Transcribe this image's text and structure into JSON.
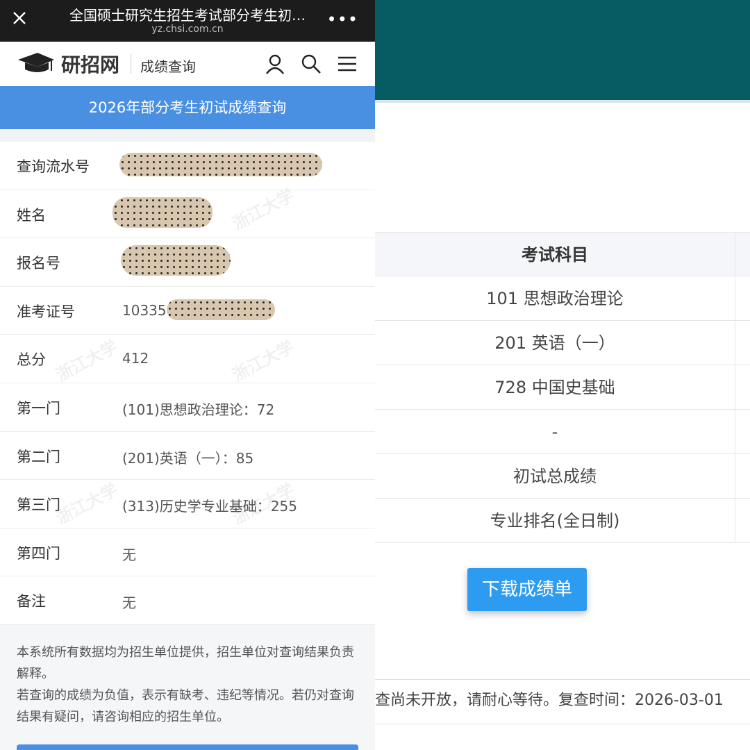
{
  "browser": {
    "title": "全国硕士研究生招生考试部分考生初…",
    "url": "yz.chsi.com.cn"
  },
  "site": {
    "name": "研招网",
    "section": "成绩查询"
  },
  "banner": "2026年部分考生初试成绩查询",
  "watermark": "浙江大学",
  "fields": [
    {
      "label": "查询流水号",
      "value": ""
    },
    {
      "label": "姓名",
      "value": ""
    },
    {
      "label": "报名号",
      "value": ""
    },
    {
      "label": "准考证号",
      "value": "10335"
    },
    {
      "label": "总分",
      "value": "412"
    },
    {
      "label": "第一门",
      "value": "(101)思想政治理论：72"
    },
    {
      "label": "第二门",
      "value": "(201)英语（一）：85"
    },
    {
      "label": "第三门",
      "value": "(313)历史学专业基础：255"
    },
    {
      "label": "第四门",
      "value": "无"
    },
    {
      "label": "备注",
      "value": "无"
    }
  ],
  "notice": {
    "line1": "本系统所有数据均为招生单位提供，招生单位对查询结果负责解释。",
    "line2": "若查询的成绩为负值，表示有缺考、违纪等情况。若仍对查询结果有疑问，请咨询相应的招生单位。"
  },
  "score_table": {
    "header": "考试科目",
    "rows": [
      "101 思想政治理论",
      "201 英语（一）",
      "728 中国史基础",
      "-",
      "初试总成绩",
      "专业排名(全日制)"
    ]
  },
  "download_button": "下载成绩单",
  "review_text": "查尚未开放，请耐心等待。复查时间：2026-03-01",
  "colors": {
    "banner_blue": "#4a90e2",
    "teal_header": "#075c63",
    "button_blue": "#2d9cf0"
  }
}
